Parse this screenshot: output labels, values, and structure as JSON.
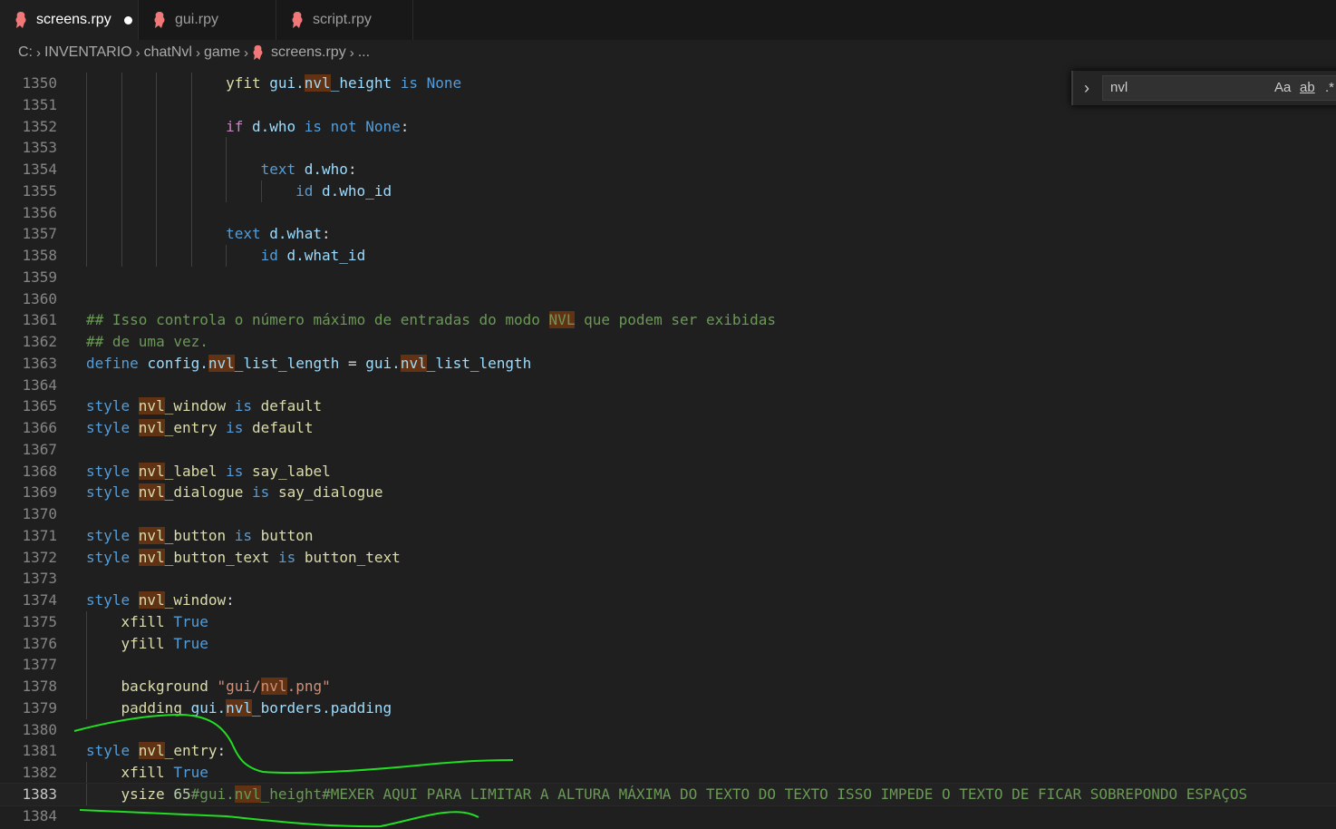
{
  "tabs": [
    {
      "label": "screens.rpy",
      "active": true,
      "modified": true
    },
    {
      "label": "gui.rpy",
      "active": false,
      "modified": false
    },
    {
      "label": "script.rpy",
      "active": false,
      "modified": false
    }
  ],
  "breadcrumb": [
    "C:",
    "INVENTARIO",
    "chatNvl",
    "game",
    "screens.rpy",
    "..."
  ],
  "find": {
    "query": "nvl",
    "opt_case": "Aa",
    "opt_word": "ab",
    "opt_regex": ".*"
  },
  "colors": {
    "annotation": "#22dd22",
    "match_highlight": "#613214",
    "file_icon": "#f07878"
  },
  "editor": {
    "lines": [
      {
        "n": "1350",
        "indent": 4,
        "tokens": [
          {
            "t": "yfit ",
            "c": "prop"
          },
          {
            "t": "gui.",
            "c": "id"
          },
          {
            "t": "nvl",
            "c": "id",
            "h": true
          },
          {
            "t": "_height ",
            "c": "id"
          },
          {
            "t": "is ",
            "c": "kw"
          },
          {
            "t": "None",
            "c": "kw"
          }
        ]
      },
      {
        "n": "1351",
        "indent": 4,
        "tokens": []
      },
      {
        "n": "1352",
        "indent": 4,
        "tokens": [
          {
            "t": "if ",
            "c": "kw2"
          },
          {
            "t": "d.who ",
            "c": "id"
          },
          {
            "t": "is not ",
            "c": "kw"
          },
          {
            "t": "None",
            "c": "kw"
          },
          {
            "t": ":",
            "c": "pl"
          }
        ]
      },
      {
        "n": "1353",
        "indent": 5,
        "tokens": []
      },
      {
        "n": "1354",
        "indent": 5,
        "tokens": [
          {
            "t": "text ",
            "c": "kw"
          },
          {
            "t": "d.who",
            "c": "id"
          },
          {
            "t": ":",
            "c": "pl"
          }
        ]
      },
      {
        "n": "1355",
        "indent": 6,
        "tokens": [
          {
            "t": "id ",
            "c": "kw"
          },
          {
            "t": "d.who_id",
            "c": "id"
          }
        ]
      },
      {
        "n": "1356",
        "indent": 4,
        "tokens": []
      },
      {
        "n": "1357",
        "indent": 4,
        "tokens": [
          {
            "t": "text ",
            "c": "kw"
          },
          {
            "t": "d.what",
            "c": "id"
          },
          {
            "t": ":",
            "c": "pl"
          }
        ]
      },
      {
        "n": "1358",
        "indent": 5,
        "tokens": [
          {
            "t": "id ",
            "c": "kw"
          },
          {
            "t": "d.what_id",
            "c": "id"
          }
        ]
      },
      {
        "n": "1359",
        "indent": 0,
        "tokens": []
      },
      {
        "n": "1360",
        "indent": 0,
        "tokens": []
      },
      {
        "n": "1361",
        "indent": 0,
        "tokens": [
          {
            "t": "## Isso controla o número máximo de entradas do modo ",
            "c": "com"
          },
          {
            "t": "NVL",
            "c": "com",
            "h": true
          },
          {
            "t": " que podem ser exibidas",
            "c": "com"
          }
        ]
      },
      {
        "n": "1362",
        "indent": 0,
        "tokens": [
          {
            "t": "## de uma vez.",
            "c": "com"
          }
        ]
      },
      {
        "n": "1363",
        "indent": 0,
        "tokens": [
          {
            "t": "define ",
            "c": "kw"
          },
          {
            "t": "config.",
            "c": "id"
          },
          {
            "t": "nvl",
            "c": "id",
            "h": true
          },
          {
            "t": "_list_length ",
            "c": "id"
          },
          {
            "t": "= ",
            "c": "pl"
          },
          {
            "t": "gui.",
            "c": "id"
          },
          {
            "t": "nvl",
            "c": "id",
            "h": true
          },
          {
            "t": "_list_length",
            "c": "id"
          }
        ]
      },
      {
        "n": "1364",
        "indent": 0,
        "tokens": []
      },
      {
        "n": "1365",
        "indent": 0,
        "tokens": [
          {
            "t": "style ",
            "c": "kw"
          },
          {
            "t": "nvl",
            "c": "prop",
            "h": true
          },
          {
            "t": "_window ",
            "c": "prop"
          },
          {
            "t": "is ",
            "c": "kw"
          },
          {
            "t": "default",
            "c": "prop"
          }
        ]
      },
      {
        "n": "1366",
        "indent": 0,
        "tokens": [
          {
            "t": "style ",
            "c": "kw"
          },
          {
            "t": "nvl",
            "c": "prop",
            "h": true
          },
          {
            "t": "_entry ",
            "c": "prop"
          },
          {
            "t": "is ",
            "c": "kw"
          },
          {
            "t": "default",
            "c": "prop"
          }
        ]
      },
      {
        "n": "1367",
        "indent": 0,
        "tokens": []
      },
      {
        "n": "1368",
        "indent": 0,
        "tokens": [
          {
            "t": "style ",
            "c": "kw"
          },
          {
            "t": "nvl",
            "c": "prop",
            "h": true
          },
          {
            "t": "_label ",
            "c": "prop"
          },
          {
            "t": "is ",
            "c": "kw"
          },
          {
            "t": "say_label",
            "c": "prop"
          }
        ]
      },
      {
        "n": "1369",
        "indent": 0,
        "tokens": [
          {
            "t": "style ",
            "c": "kw"
          },
          {
            "t": "nvl",
            "c": "prop",
            "h": true
          },
          {
            "t": "_dialogue ",
            "c": "prop"
          },
          {
            "t": "is ",
            "c": "kw"
          },
          {
            "t": "say_dialogue",
            "c": "prop"
          }
        ]
      },
      {
        "n": "1370",
        "indent": 0,
        "tokens": []
      },
      {
        "n": "1371",
        "indent": 0,
        "tokens": [
          {
            "t": "style ",
            "c": "kw"
          },
          {
            "t": "nvl",
            "c": "prop",
            "h": true
          },
          {
            "t": "_button ",
            "c": "prop"
          },
          {
            "t": "is ",
            "c": "kw"
          },
          {
            "t": "button",
            "c": "prop"
          }
        ]
      },
      {
        "n": "1372",
        "indent": 0,
        "tokens": [
          {
            "t": "style ",
            "c": "kw"
          },
          {
            "t": "nvl",
            "c": "prop",
            "h": true
          },
          {
            "t": "_button_text ",
            "c": "prop"
          },
          {
            "t": "is ",
            "c": "kw"
          },
          {
            "t": "button_text",
            "c": "prop"
          }
        ]
      },
      {
        "n": "1373",
        "indent": 0,
        "tokens": []
      },
      {
        "n": "1374",
        "indent": 0,
        "tokens": [
          {
            "t": "style ",
            "c": "kw"
          },
          {
            "t": "nvl",
            "c": "prop",
            "h": true
          },
          {
            "t": "_window",
            "c": "prop"
          },
          {
            "t": ":",
            "c": "pl"
          }
        ]
      },
      {
        "n": "1375",
        "indent": 1,
        "tokens": [
          {
            "t": "xfill ",
            "c": "prop"
          },
          {
            "t": "True",
            "c": "kw"
          }
        ]
      },
      {
        "n": "1376",
        "indent": 1,
        "tokens": [
          {
            "t": "yfill ",
            "c": "prop"
          },
          {
            "t": "True",
            "c": "kw"
          }
        ]
      },
      {
        "n": "1377",
        "indent": 1,
        "tokens": []
      },
      {
        "n": "1378",
        "indent": 1,
        "tokens": [
          {
            "t": "background ",
            "c": "prop"
          },
          {
            "t": "\"gui/",
            "c": "str"
          },
          {
            "t": "nvl",
            "c": "str",
            "h": true
          },
          {
            "t": ".png\"",
            "c": "str"
          }
        ]
      },
      {
        "n": "1379",
        "indent": 1,
        "tokens": [
          {
            "t": "padding ",
            "c": "prop"
          },
          {
            "t": "gui.",
            "c": "id"
          },
          {
            "t": "nvl",
            "c": "id",
            "h": true
          },
          {
            "t": "_borders.padding",
            "c": "id"
          }
        ]
      },
      {
        "n": "1380",
        "indent": 0,
        "tokens": []
      },
      {
        "n": "1381",
        "indent": 0,
        "tokens": [
          {
            "t": "style ",
            "c": "kw"
          },
          {
            "t": "nvl",
            "c": "prop",
            "h": true
          },
          {
            "t": "_entry",
            "c": "prop"
          },
          {
            "t": ":",
            "c": "pl"
          }
        ]
      },
      {
        "n": "1382",
        "indent": 1,
        "tokens": [
          {
            "t": "xfill ",
            "c": "prop"
          },
          {
            "t": "True",
            "c": "kw"
          }
        ]
      },
      {
        "n": "1383",
        "indent": 1,
        "current": true,
        "tokens": [
          {
            "t": "ysize ",
            "c": "prop"
          },
          {
            "t": "65",
            "c": "num"
          },
          {
            "t": "#gui.",
            "c": "com"
          },
          {
            "t": "nvl",
            "c": "com",
            "h": true
          },
          {
            "t": "_height#MEXER AQUI PARA LIMITAR A ALTURA MÁXIMA DO TEXTO DO TEXTO ISSO IMPEDE O TEXTO DE FICAR SOBREPONDO ESPAÇOS",
            "c": "com"
          }
        ]
      },
      {
        "n": "1384",
        "indent": 0,
        "tokens": []
      }
    ]
  }
}
